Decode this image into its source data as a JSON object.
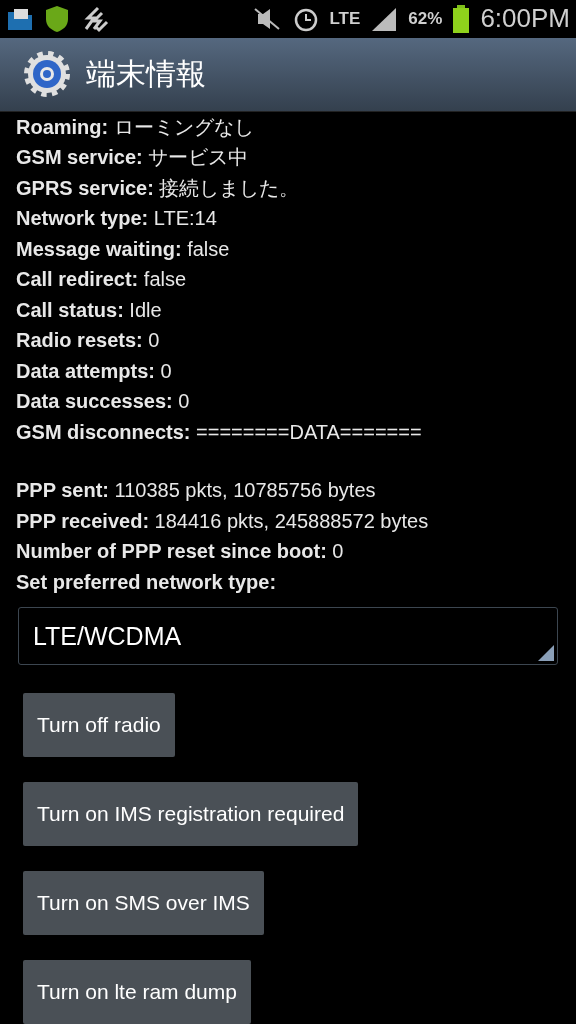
{
  "status_bar": {
    "network": "LTE",
    "battery": "62%",
    "time": "6:00PM"
  },
  "header": {
    "title": "端末情報"
  },
  "radio_info": [
    "**Roaming:** ローミングなし",
    "**GSM service:** サービス中",
    "**GPRS service:** 接続しました。",
    "**Network type:** LTE:14",
    "**Message waiting:** false",
    "**Call redirect:** false",
    "**Call status:** Idle",
    "**Radio resets:** 0",
    "**Data attempts:** 0",
    "**Data successes:** 0",
    "**GSM disconnects:** ========DATA======="
  ],
  "ppp_info": [
    "**PPP sent:** 110385 pkts, 10785756 bytes",
    "**PPP received:** 184416 pkts, 245888572 bytes",
    "**Number of PPP reset since boot:** 0",
    "**Set preferred network type:**"
  ],
  "network_type_select": {
    "value": "LTE/WCDMA"
  },
  "buttons": [
    "Turn off radio",
    "Turn on IMS registration required",
    "Turn on SMS over IMS",
    "Turn on lte ram dump"
  ]
}
